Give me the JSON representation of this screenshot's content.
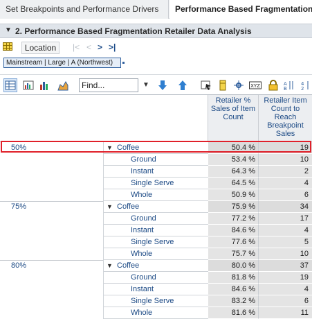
{
  "tabs": [
    {
      "label": "Set Breakpoints and Performance Drivers"
    },
    {
      "label": "Performance Based Fragmentation"
    }
  ],
  "section": {
    "title": "2. Performance Based Fragmentation Retailer Data Analysis"
  },
  "location": {
    "button_label": "Location",
    "nav": [
      "|<",
      "<",
      ">",
      ">|"
    ]
  },
  "filter_chip": {
    "label": "Mainstream | Large | A (Northwest)"
  },
  "toolbar": {
    "find_placeholder": "Find...",
    "icons": [
      "table-view-icon",
      "chart-table-icon",
      "bar-chart-icon",
      "area-chart-icon",
      "sort-down-icon",
      "sort-up-icon",
      "filter-icon",
      "column-icon",
      "settings-icon",
      "xyz-icon",
      "lock-icon",
      "swap-icon"
    ]
  },
  "table": {
    "columns": [
      "Retailer % Sales of Item Count",
      "Retailer Item Count to Reach Breakpoint Sales"
    ],
    "groups": [
      {
        "breakpoint": "50%",
        "rows": [
          {
            "label": "Coffee",
            "pct": "50.4 %",
            "count": "19",
            "top": true
          },
          {
            "label": "Ground",
            "pct": "53.4 %",
            "count": "10"
          },
          {
            "label": "Instant",
            "pct": "64.3 %",
            "count": "2"
          },
          {
            "label": "Single Serve",
            "pct": "64.5 %",
            "count": "4"
          },
          {
            "label": "Whole",
            "pct": "50.9 %",
            "count": "6"
          }
        ]
      },
      {
        "breakpoint": "75%",
        "rows": [
          {
            "label": "Coffee",
            "pct": "75.9 %",
            "count": "34",
            "top": true
          },
          {
            "label": "Ground",
            "pct": "77.2 %",
            "count": "17"
          },
          {
            "label": "Instant",
            "pct": "84.6 %",
            "count": "4"
          },
          {
            "label": "Single Serve",
            "pct": "77.6 %",
            "count": "5"
          },
          {
            "label": "Whole",
            "pct": "75.7 %",
            "count": "10"
          }
        ]
      },
      {
        "breakpoint": "80%",
        "rows": [
          {
            "label": "Coffee",
            "pct": "80.0 %",
            "count": "37",
            "top": true
          },
          {
            "label": "Ground",
            "pct": "81.8 %",
            "count": "19"
          },
          {
            "label": "Instant",
            "pct": "84.6 %",
            "count": "4"
          },
          {
            "label": "Single Serve",
            "pct": "83.2 %",
            "count": "6"
          },
          {
            "label": "Whole",
            "pct": "81.6 %",
            "count": "11"
          }
        ]
      }
    ]
  },
  "colors": {
    "accent": "#1c4a85",
    "highlight": "#e0202a",
    "header_bg": "#dfe4ea"
  }
}
